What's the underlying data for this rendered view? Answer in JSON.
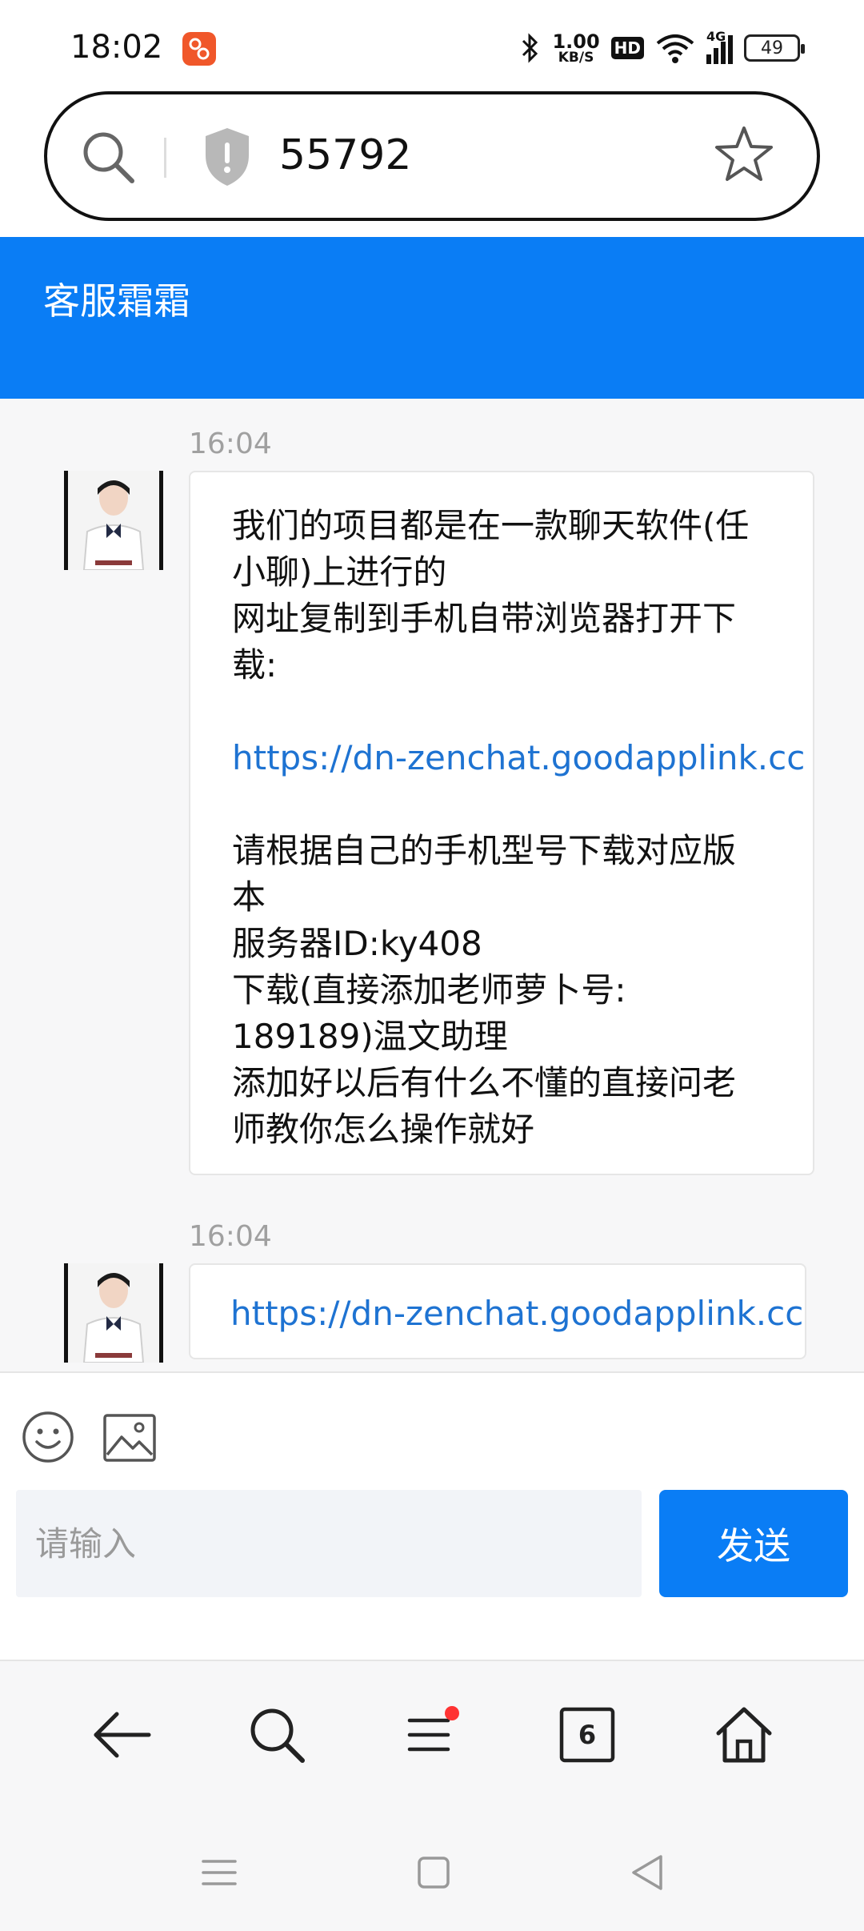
{
  "status_bar": {
    "time": "18:02",
    "net_speed_value": "1.00",
    "net_speed_unit": "KB/S",
    "hd_label": "HD",
    "signal_label": "4G",
    "battery": "49"
  },
  "address_bar": {
    "text": "55792",
    "icons": [
      "search-icon",
      "shield-icon",
      "star-icon"
    ]
  },
  "chat": {
    "title": "客服霜霜",
    "messages": [
      {
        "time": "16:04",
        "lines": [
          {
            "text": "我们的项目都是在一款聊天软件(任",
            "type": "text"
          },
          {
            "text": "小聊)上进行的",
            "type": "text"
          },
          {
            "text": "网址复制到手机自带浏览器打开下",
            "type": "text"
          },
          {
            "text": "载:",
            "type": "text"
          },
          {
            "text": "",
            "type": "blank"
          },
          {
            "text": "https://dn-zenchat.goodapplink.cc",
            "type": "link"
          },
          {
            "text": "",
            "type": "blank"
          },
          {
            "text": "请根据自己的手机型号下载对应版",
            "type": "text"
          },
          {
            "text": "本",
            "type": "text"
          },
          {
            "text": "服务器ID:ky408",
            "type": "text"
          },
          {
            "text": "下载(直接添加老师萝卜号:",
            "type": "text"
          },
          {
            "text": "189189)温文助理",
            "type": "text"
          },
          {
            "text": "添加好以后有什么不懂的直接问老",
            "type": "text"
          },
          {
            "text": "师教你怎么操作就好",
            "type": "text"
          }
        ]
      },
      {
        "time": "16:04",
        "lines": [
          {
            "text": "https://dn-zenchat.goodapplink.cc",
            "type": "link"
          }
        ]
      }
    ]
  },
  "composer": {
    "placeholder": "请输入",
    "send_label": "发送",
    "icons": [
      "emoji-icon",
      "image-icon"
    ]
  },
  "browser_nav": {
    "tab_count": "6",
    "icons": [
      "back-arrow-icon",
      "search-icon",
      "menu-icon",
      "tabs-icon",
      "home-icon"
    ],
    "accent_dot_color": "#ff3333"
  },
  "colors": {
    "accent": "#0a7df5",
    "link": "#1e73d2"
  }
}
